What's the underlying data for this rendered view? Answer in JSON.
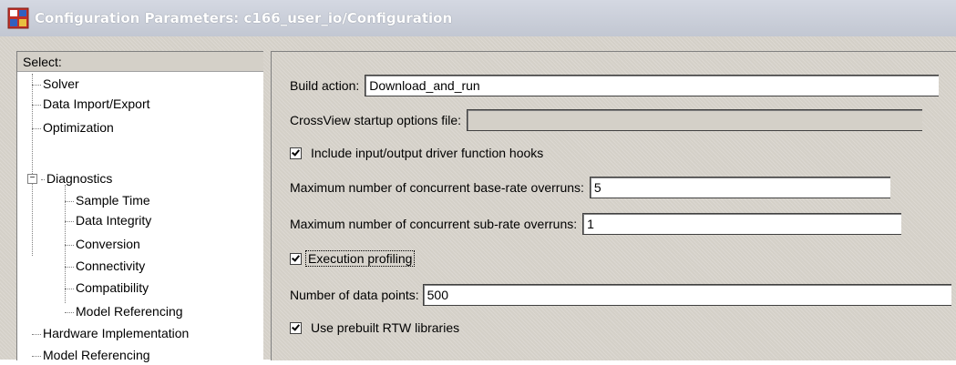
{
  "window": {
    "title": "Configuration Parameters: c166_user_io/Configuration",
    "icon": "simulink-model-icon"
  },
  "sidebar": {
    "select_label": "Select:",
    "items": [
      {
        "label": "Solver",
        "level": 0
      },
      {
        "label": "Data Import/Export",
        "level": 0
      },
      {
        "label": "Optimization",
        "level": 0
      },
      {
        "label": "Diagnostics",
        "level": 0,
        "expanded": true
      },
      {
        "label": "Sample Time",
        "level": 1
      },
      {
        "label": "Data Integrity",
        "level": 1
      },
      {
        "label": "Conversion",
        "level": 1
      },
      {
        "label": "Connectivity",
        "level": 1
      },
      {
        "label": "Compatibility",
        "level": 1
      },
      {
        "label": "Model Referencing",
        "level": 1
      },
      {
        "label": "Hardware Implementation",
        "level": 0
      },
      {
        "label": "Model Referencing",
        "level": 0
      }
    ]
  },
  "form": {
    "build_action": {
      "label": "Build action:",
      "value": "Download_and_run"
    },
    "crossview": {
      "label": "CrossView startup options file:",
      "value": ""
    },
    "include_hooks": {
      "label": "Include input/output driver function hooks",
      "checked": true
    },
    "max_base_rate": {
      "label": "Maximum number of concurrent base-rate overruns:",
      "value": "5"
    },
    "max_sub_rate": {
      "label": "Maximum number of concurrent sub-rate overruns:",
      "value": "1"
    },
    "execution_profiling": {
      "label": "Execution profiling",
      "checked": true
    },
    "num_data_points": {
      "label": "Number of data points:",
      "value": "500"
    },
    "prebuilt_rtw": {
      "label": "Use prebuilt RTW libraries",
      "checked": true
    }
  }
}
